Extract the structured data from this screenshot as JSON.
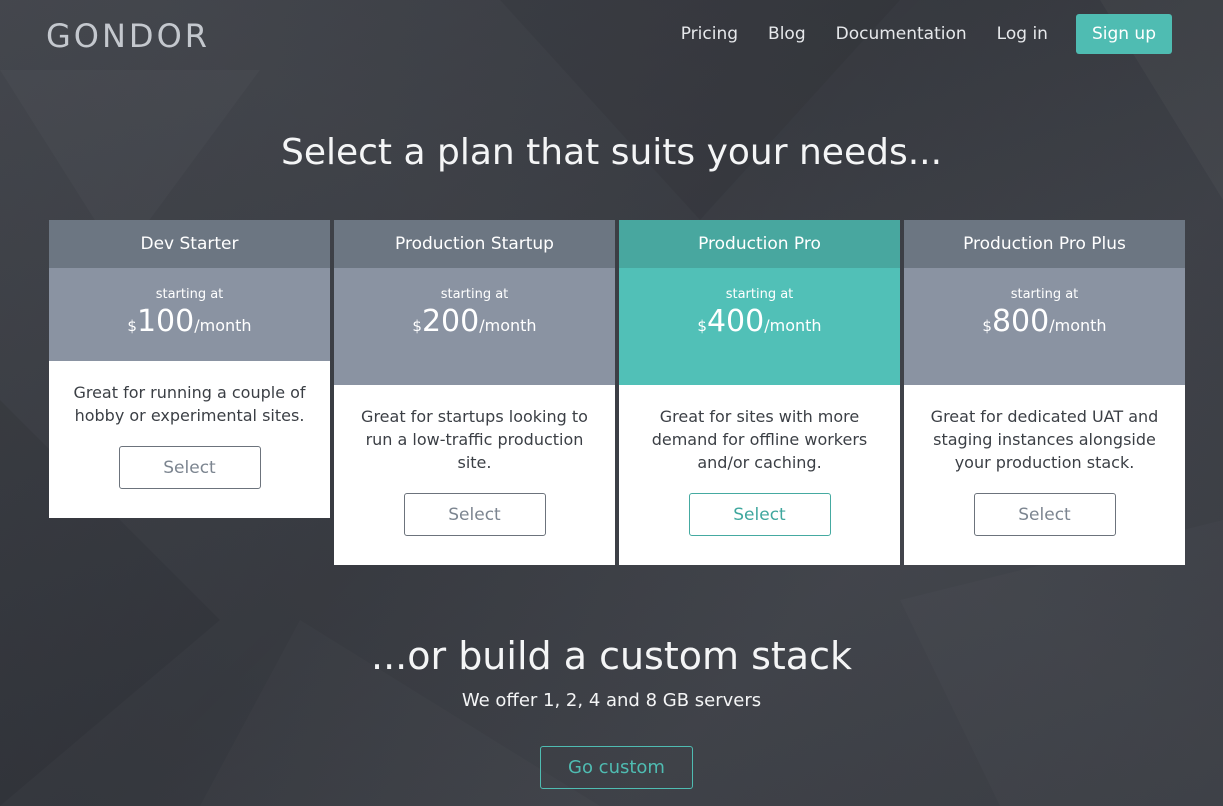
{
  "header": {
    "logo": "GONDOR",
    "nav": [
      "Pricing",
      "Blog",
      "Documentation",
      "Log in"
    ],
    "signup_label": "Sign up"
  },
  "headline": "Select a plan that suits your needs...",
  "plans": [
    {
      "name": "Dev Starter",
      "starting": "starting at",
      "currency": "$",
      "amount": "100",
      "period": "/month",
      "description": "Great for running a couple of hobby or experimental sites.",
      "button": "Select"
    },
    {
      "name": "Production Startup",
      "starting": "starting at",
      "currency": "$",
      "amount": "200",
      "period": "/month",
      "description": "Great for startups looking to run a low-traffic production site.",
      "button": "Select"
    },
    {
      "name": "Production Pro",
      "starting": "starting at",
      "currency": "$",
      "amount": "400",
      "period": "/month",
      "description": "Great for sites with more demand for offline workers and/or caching.",
      "button": "Select"
    },
    {
      "name": "Production Pro Plus",
      "starting": "starting at",
      "currency": "$",
      "amount": "800",
      "period": "/month",
      "description": "Great for dedicated UAT and staging instances alongside your production stack.",
      "button": "Select"
    }
  ],
  "custom": {
    "title": "...or build a custom stack",
    "subtitle": "We offer 1, 2, 4 and 8 GB servers",
    "button": "Go custom"
  },
  "colors": {
    "background": "#3a3d44",
    "accent": "#4fbcb2",
    "plan_header": "#6c7682",
    "plan_price": "#8a93a2"
  }
}
